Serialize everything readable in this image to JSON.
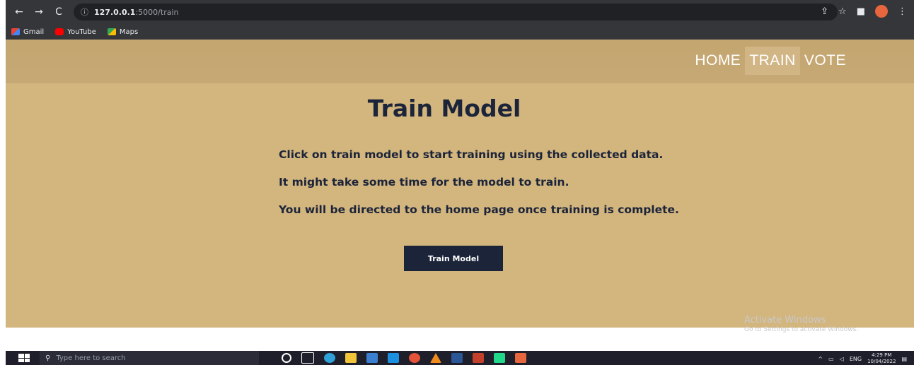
{
  "browser": {
    "url_host": "127.0.0.1",
    "url_path": ":5000/train",
    "nav": {
      "back": "←",
      "forward": "→",
      "reload": "C"
    },
    "bookmarks": [
      {
        "label": "Gmail",
        "icon": "gmail-icon"
      },
      {
        "label": "YouTube",
        "icon": "youtube-icon"
      },
      {
        "label": "Maps",
        "icon": "maps-icon"
      }
    ],
    "toolbar_icons": [
      "share-icon",
      "star-icon",
      "sidebar-icon",
      "profile-icon",
      "menu-icon"
    ]
  },
  "navbar": {
    "items": [
      {
        "label": "HOME",
        "active": false
      },
      {
        "label": "TRAIN",
        "active": true
      },
      {
        "label": "VOTE",
        "active": false
      }
    ]
  },
  "main": {
    "title": "Train Model",
    "lines": [
      "Click on train model to start training using the collected data.",
      "It might take some time for the model to train.",
      "You will be directed to the home page once training is complete."
    ],
    "button_label": "Train Model"
  },
  "watermark": {
    "line1": "Activate Windows",
    "line2": "Go to Settings to activate Windows."
  },
  "taskbar": {
    "search_placeholder": "Type here to search",
    "language": "ENG",
    "time": "4:29 PM",
    "date": "10/04/2022"
  },
  "colors": {
    "page_bg": "#d3b57e",
    "navbar_bg": "#c4a670",
    "text_dark": "#1b2439",
    "button_bg": "#1b2439"
  }
}
